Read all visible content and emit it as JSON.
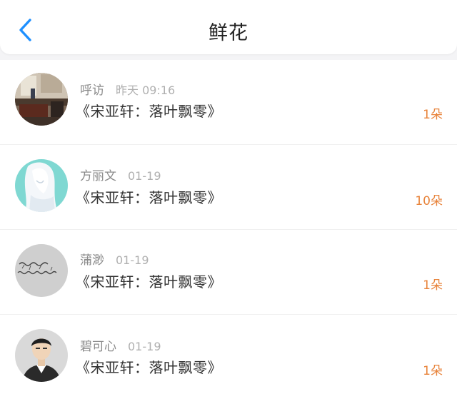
{
  "header": {
    "title": "鲜花",
    "back_icon": "chevron-left-icon"
  },
  "colors": {
    "accent_blue": "#1E90FF",
    "quantity_orange": "#E8843C",
    "meta_gray": "#9A9A9A",
    "background": "#F4F4F6"
  },
  "items": [
    {
      "name": "呼访",
      "time": "昨天 09:16",
      "book": "《宋亚轩：落叶飘零》",
      "quantity": "1朵",
      "avatar": "room-photo-avatar"
    },
    {
      "name": "方丽文",
      "time": "01-19",
      "book": "《宋亚轩：落叶飘零》",
      "quantity": "10朵",
      "avatar": "anime-girl-avatar"
    },
    {
      "name": "蒲渺",
      "time": "01-19",
      "book": "《宋亚轩：落叶飘零》",
      "quantity": "1朵",
      "avatar": "handwriting-avatar"
    },
    {
      "name": "碧可心",
      "time": "01-19",
      "book": "《宋亚轩：落叶飘零》",
      "quantity": "1朵",
      "avatar": "cartoon-man-avatar"
    }
  ]
}
